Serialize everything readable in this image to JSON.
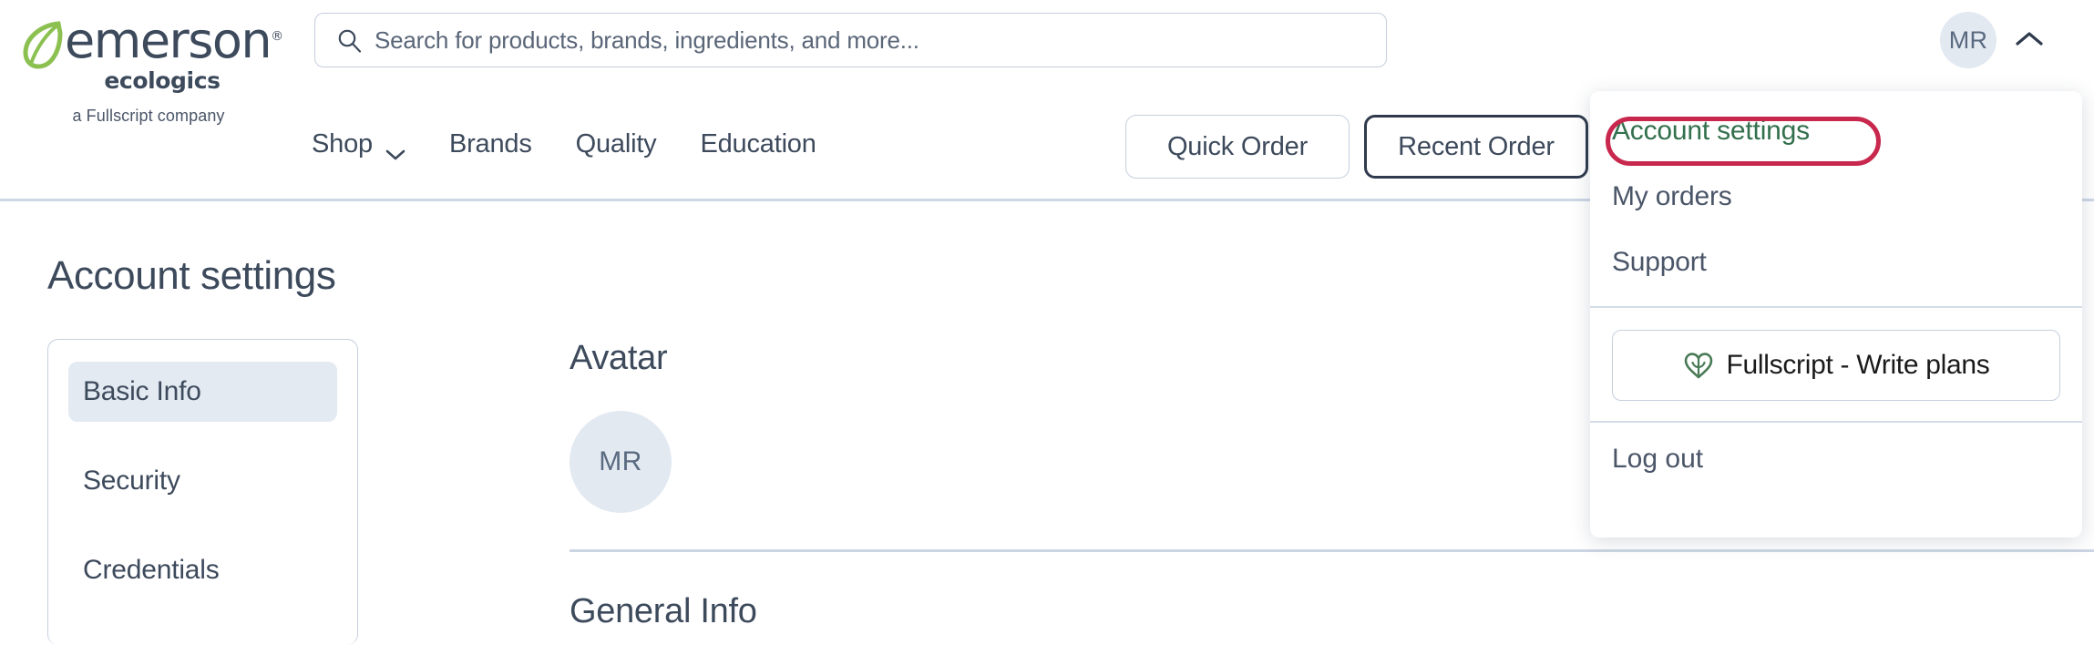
{
  "brand": {
    "name": "emerson",
    "registered": "®",
    "subname": "ecologics",
    "tagline": "a Fullscript company"
  },
  "search": {
    "placeholder": "Search for products, brands, ingredients, and more...",
    "value": "",
    "icon": "search-icon"
  },
  "header": {
    "avatar_initials": "MR",
    "chevron_icon": "chevron-up-icon",
    "nav": [
      {
        "label": "Shop",
        "has_caret": true,
        "caret_icon": "chevron-down-icon"
      },
      {
        "label": "Brands",
        "has_caret": false
      },
      {
        "label": "Quality",
        "has_caret": false
      },
      {
        "label": "Education",
        "has_caret": false
      }
    ],
    "buttons": [
      {
        "label": "Quick Order",
        "focused": false
      },
      {
        "label": "Recent Order",
        "focused": true
      }
    ]
  },
  "account_menu": {
    "items": [
      {
        "label": "Account settings",
        "highlighted": true
      },
      {
        "label": "My orders",
        "highlighted": false
      },
      {
        "label": "Support",
        "highlighted": false
      }
    ],
    "fullscript_button": {
      "label": "Fullscript - Write plans",
      "icon": "fullscript-leaf-icon"
    },
    "logout_label": "Log out",
    "highlight_color": "#c8284d",
    "highlighted_text_color": "#33704d"
  },
  "page": {
    "title": "Account settings"
  },
  "sidebar": {
    "items": [
      {
        "label": "Basic Info",
        "active": true
      },
      {
        "label": "Security",
        "active": false
      },
      {
        "label": "Credentials",
        "active": false
      }
    ]
  },
  "main": {
    "avatar_section_title": "Avatar",
    "avatar_initials": "MR",
    "general_info_title": "General Info"
  },
  "colors": {
    "text": "#3d4a5c",
    "muted": "#4a5568",
    "border": "#c5cfdd",
    "accent_green": "#33704d",
    "annotation_red": "#c8284d",
    "avatar_bg": "#e3e9f1",
    "active_bg": "#e4eaf2",
    "leaf_green": "#8cc152"
  }
}
